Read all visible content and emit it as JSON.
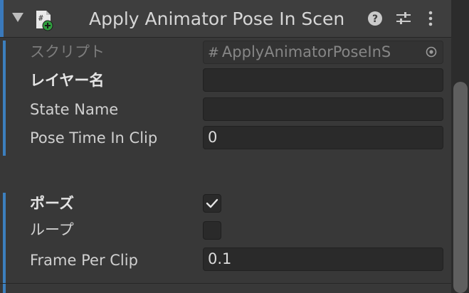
{
  "component": {
    "title": "Apply Animator Pose In Scen",
    "enabled": true,
    "foldout": "expanded",
    "icons": {
      "foldout": "triangle-down-icon",
      "script": "cs-script-icon",
      "help": "help-icon",
      "presets": "sliders-icon",
      "menu": "kebab-menu-icon"
    }
  },
  "properties": {
    "script": {
      "label": "スクリプト",
      "value": "ApplyAnimatorPoseInS",
      "hash": "#",
      "picker_icon": "object-picker-icon"
    },
    "layer_name": {
      "label": "レイヤー名",
      "value": ""
    },
    "state_name": {
      "label": "State Name",
      "value": ""
    },
    "pose_time": {
      "label": "Pose Time In Clip",
      "value": "0"
    },
    "pose": {
      "label": "ポーズ",
      "checked": true
    },
    "loop": {
      "label": "ループ",
      "checked": false
    },
    "frame_per_clip": {
      "label": "Frame Per Clip",
      "value": "0.1"
    }
  },
  "colors": {
    "accent": "#3a79bb",
    "background": "#383838",
    "field": "#2a2a2a"
  }
}
